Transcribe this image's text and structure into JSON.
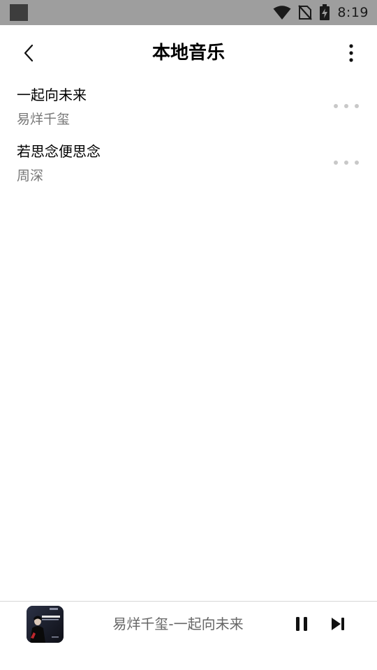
{
  "status_bar": {
    "time": "8:19",
    "icons": [
      "app-notification-icon",
      "wifi-icon",
      "no-sim-icon",
      "battery-charging-icon"
    ]
  },
  "header": {
    "title": "本地音乐",
    "back_icon": "chevron-left-icon",
    "more_icon": "more-vertical-icon"
  },
  "songs": [
    {
      "title": "一起向未来",
      "artist": "易烊千玺"
    },
    {
      "title": "若思念便思念",
      "artist": "周深"
    }
  ],
  "player": {
    "now_playing": "易烊千玺-一起向未来",
    "album_art_text": "一起向未来",
    "controls": [
      "pause-icon",
      "skip-next-icon"
    ]
  },
  "colors": {
    "status_bar": "#9e9e9e",
    "secondary_text": "#777777",
    "dots": "#c8c8c8"
  }
}
